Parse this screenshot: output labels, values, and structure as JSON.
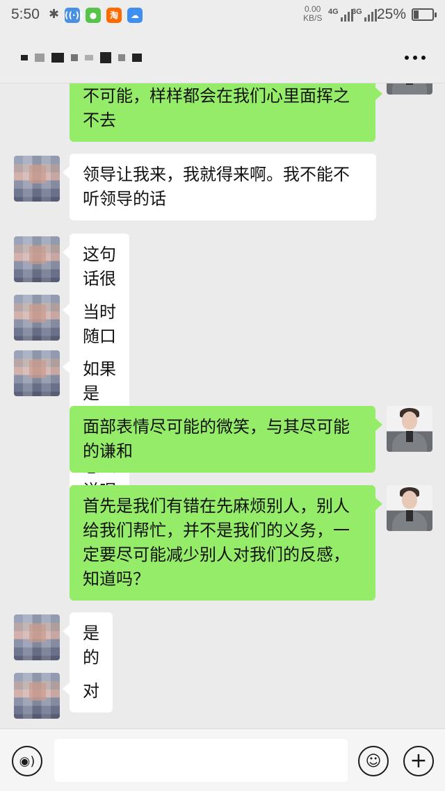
{
  "status_bar": {
    "time": "5:50",
    "net_speed_value": "0.00",
    "net_speed_unit": "KB/S",
    "network_1": "4G",
    "network_2": "3G",
    "battery_percent": "25%",
    "app_icons": [
      "signal-app-icon",
      "wechat-icon",
      "taobao-icon",
      "cloud-icon"
    ],
    "taobao_glyph": "淘"
  },
  "header": {
    "more_icon": "more-icon"
  },
  "messages": [
    {
      "side": "right",
      "avatar": "my-avatar",
      "text": "不可能，样样都会在我们心里面挥之不去"
    },
    {
      "side": "left",
      "avatar": "contact-avatar",
      "text": "领导让我来，我就得来啊。我不能不听领导的话"
    },
    {
      "side": "left",
      "avatar": "contact-avatar",
      "text": "这句话很硬吗？"
    },
    {
      "side": "left",
      "avatar": "contact-avatar",
      "text": "当时随口一说，事后感觉不妥"
    },
    {
      "side": "left",
      "avatar": "contact-avatar",
      "text": "如果是你，应该怎么说呢"
    },
    {
      "side": "right",
      "avatar": "my-avatar",
      "text": "面部表情尽可能的微笑，与其尽可能的谦和"
    },
    {
      "side": "right",
      "avatar": "my-avatar",
      "text": "首先是我们有错在先麻烦别人，别人给我们帮忙，并不是我们的义务，一定要尽可能减少别人对我们的反感，知道吗？"
    },
    {
      "side": "left",
      "avatar": "contact-avatar",
      "text": "是的"
    },
    {
      "side": "left",
      "avatar": "contact-avatar",
      "text": "对"
    }
  ],
  "input_bar": {
    "voice_icon": "voice-icon",
    "voice_glyph": "◉)",
    "emoji_icon": "emoji-icon",
    "emoji_glyph": "☺",
    "plus_icon": "plus-icon",
    "plus_glyph": "+",
    "input_value": "",
    "input_placeholder": ""
  },
  "colors": {
    "background": "#ebebeb",
    "bubble_self": "#95ec69",
    "bubble_other": "#ffffff"
  }
}
